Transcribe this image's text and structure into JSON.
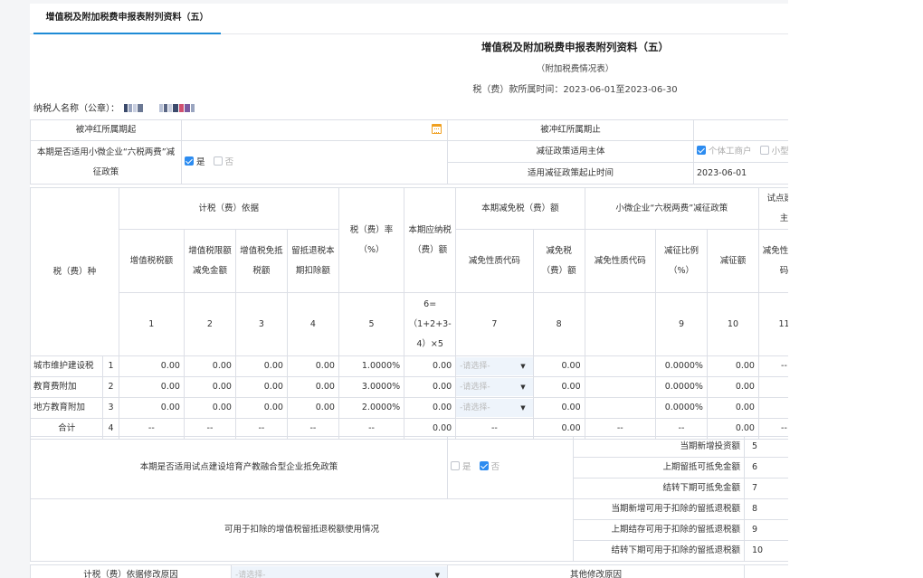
{
  "tab": {
    "label": "增值税及附加税费申报表附列资料（五）"
  },
  "header": {
    "title": "增值税及附加税费申报表附列资料（五）",
    "subtitle": "（附加税费情况表）",
    "period": "税（费）款所属时间：2023-06-01至2023-06-30"
  },
  "payer_label": "纳税人名称（公章）：",
  "top": {
    "offset_start": "被冲红所属期起",
    "offset_end": "被冲红所属期止",
    "small_policy_q": "本期是否适用小微企业“六税两费”减征政策",
    "yes": "是",
    "no": "否",
    "subject_label": "减征政策适用主体",
    "subject_opt1": "个体工商户",
    "subject_opt2": "小型",
    "time_label": "适用减征政策起止时间",
    "time_value": "2023-06-01"
  },
  "head": {
    "tax_type": "税（费）种",
    "basis": "计税（费）依据",
    "vat": "增值税税额",
    "vat_relief": "增值税限额减免金额",
    "vat_exempt": "增值税免抵税额",
    "credit": "留抵退税本期扣除额",
    "rate": "税（费）率（%）",
    "payable": "本期应纳税（费）额",
    "relief_group": "本期减免税（费）额",
    "relief_code": "减免性质代码",
    "relief_amt": "减免税（费）额",
    "small_group": "小微企业“六税两费”减征政策",
    "small_code": "减免性质代码",
    "small_ratio": "减征比例（%）",
    "small_amt": "减征额",
    "pilot_group": "试点建设",
    "pilot_group2": "主",
    "pilot_code": "减免性质代码"
  },
  "numrow": [
    "1",
    "2",
    "3",
    "4",
    "5",
    "6=（1+2+3-4）×5",
    "7",
    "8",
    "",
    "9",
    "10",
    "11"
  ],
  "rows": [
    {
      "name": "城市维护建设税",
      "no": "1",
      "c1": "0.00",
      "c2": "0.00",
      "c3": "0.00",
      "c4": "0.00",
      "rate": "1.0000%",
      "c6": "0.00",
      "sel": "-请选择-",
      "c8": "0.00",
      "c9": "0.0000%",
      "c10": "0.00",
      "c11": "--"
    },
    {
      "name": "教育费附加",
      "no": "2",
      "c1": "0.00",
      "c2": "0.00",
      "c3": "0.00",
      "c4": "0.00",
      "rate": "3.0000%",
      "c6": "0.00",
      "sel": "-请选择-",
      "c8": "0.00",
      "c9": "0.0000%",
      "c10": "0.00",
      "c11": ""
    },
    {
      "name": "地方教育附加",
      "no": "3",
      "c1": "0.00",
      "c2": "0.00",
      "c3": "0.00",
      "c4": "0.00",
      "rate": "2.0000%",
      "c6": "0.00",
      "sel": "-请选择-",
      "c8": "0.00",
      "c9": "0.0000%",
      "c10": "0.00",
      "c11": ""
    }
  ],
  "total": {
    "name": "合计",
    "no": "4",
    "dash": "--",
    "c6": "0.00",
    "c8": "0.00",
    "c10": "0.00"
  },
  "pilot": {
    "question": "本期是否适用试点建设培育产教融合型企业抵免政策",
    "yes": "是",
    "no": "否",
    "items": [
      {
        "label": "当期新增投资额",
        "no": "5"
      },
      {
        "label": "上期留抵可抵免金额",
        "no": "6"
      },
      {
        "label": "结转下期可抵免金额",
        "no": "7"
      }
    ]
  },
  "credit": {
    "label": "可用于扣除的增值税留抵退税额使用情况",
    "items": [
      {
        "label": "当期新增可用于扣除的留抵退税额",
        "no": "8"
      },
      {
        "label": "上期结存可用于扣除的留抵退税额",
        "no": "9"
      },
      {
        "label": "结转下期可用于扣除的留抵退税额",
        "no": "10"
      }
    ]
  },
  "bottom": {
    "basis_reason": "计税（费）依据修改原因",
    "select": "-请选择-",
    "other_reason": "其他修改原因"
  },
  "colors": {
    "accent": "#1e8bd6",
    "check": "#2d8cf0",
    "calendar": "#f0a020"
  }
}
